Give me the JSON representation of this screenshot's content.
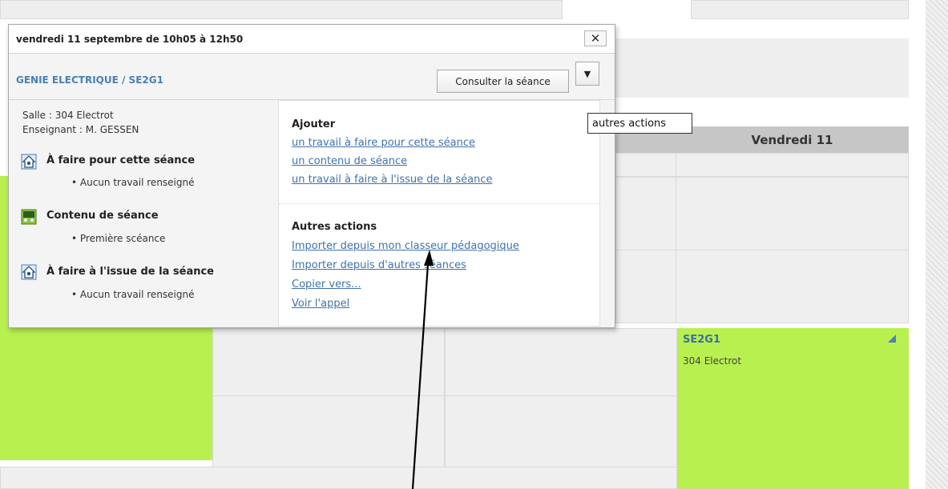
{
  "popup": {
    "title": "vendredi 11 septembre de 10h05 à 12h50",
    "close_label": "✕",
    "course": "GENIE ELECTRIQUE / SE2G1",
    "consult_label": "Consulter la séance",
    "dropdown_glyph": "▼",
    "room": "Salle : 304 Electrot",
    "teacher": "Enseignant : M. GESSEN",
    "sections": [
      {
        "title": "À faire pour cette séance",
        "item": "• Aucun travail renseigné",
        "icon": "homework-icon"
      },
      {
        "title": "Contenu de séance",
        "item": "• Première scéance",
        "icon": "lesson-content-icon"
      },
      {
        "title": "À faire à l'issue de la séance",
        "item": "• Aucun travail renseigné",
        "icon": "homework-icon"
      }
    ]
  },
  "menu": {
    "add_heading": "Ajouter",
    "add_links": [
      "un travail à faire pour cette séance",
      "un contenu de séance",
      "un travail à faire à l'issue de la séance"
    ],
    "other_heading": "Autres actions",
    "other_links": [
      "Importer depuis mon classeur pédagogique",
      "Importer depuis d'autres séances",
      "Copier vers...",
      "Voir l'appel"
    ]
  },
  "tooltip": "autres actions",
  "calendar": {
    "day_header": "Vendredi 11",
    "event_title": "SE2G1",
    "event_room": "304 Electrot"
  },
  "colors": {
    "event_green": "#b8f04f",
    "link_blue": "#3f72af"
  }
}
